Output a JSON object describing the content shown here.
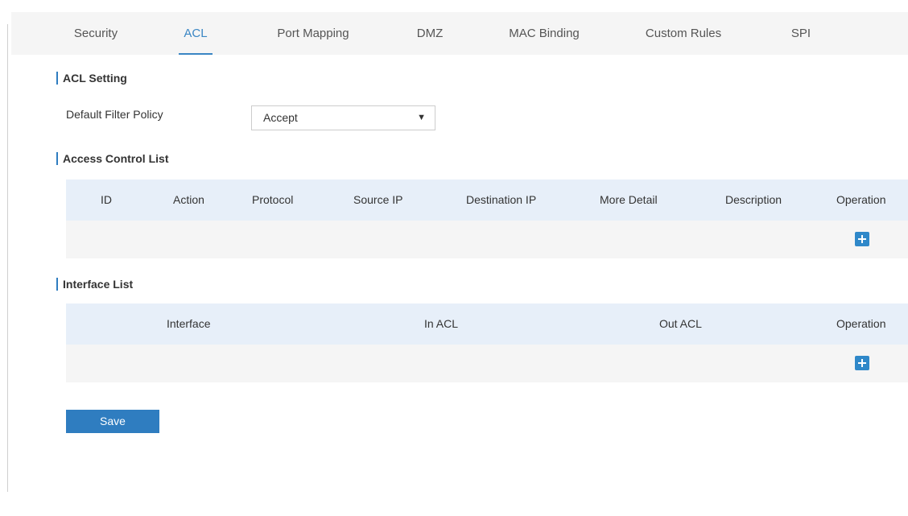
{
  "tabs": [
    "Security",
    "ACL",
    "Port Mapping",
    "DMZ",
    "MAC Binding",
    "Custom Rules",
    "SPI"
  ],
  "active_tab": "ACL",
  "acl_setting": {
    "title": "ACL Setting",
    "default_filter_policy_label": "Default Filter Policy",
    "default_filter_policy_value": "Accept"
  },
  "access_control_list": {
    "title": "Access Control List",
    "columns": [
      "ID",
      "Action",
      "Protocol",
      "Source IP",
      "Destination IP",
      "More Detail",
      "Description",
      "Operation"
    ]
  },
  "interface_list": {
    "title": "Interface List",
    "columns": [
      "Interface",
      "In ACL",
      "Out ACL",
      "Operation"
    ]
  },
  "save_label": "Save",
  "icons": {
    "add": "plus-icon",
    "dropdown": "caret-down-icon"
  },
  "colors": {
    "accent": "#2f7dc0",
    "active_tab": "#3a86c4",
    "table_header_bg": "#e7eff9",
    "table_row_bg": "#f5f5f5"
  }
}
